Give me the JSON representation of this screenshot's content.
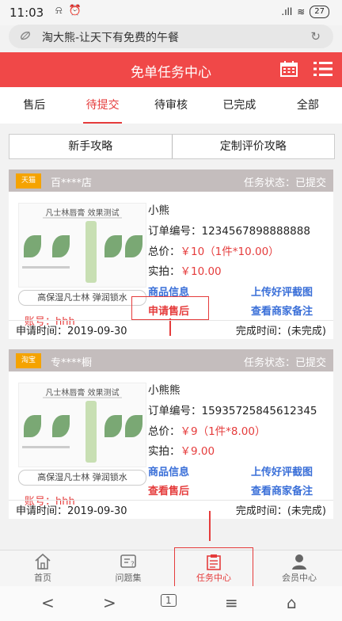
{
  "status_bar": {
    "time": "11:03",
    "alarm_icons": "⍾ ⏰",
    "signal": ".ıll",
    "wifi": "≋",
    "battery": "27"
  },
  "browser": {
    "page_title": "淘大熊-让天下有免费的午餐"
  },
  "header": {
    "title": "免单任务中心"
  },
  "tabs": [
    "售后",
    "待提交",
    "待审核",
    "已完成",
    "全部"
  ],
  "active_tab": "待提交",
  "guides": {
    "newbie": "新手攻略",
    "custom_review": "定制评价攻略"
  },
  "product_image": {
    "title": "凡士林唇膏 效果测试",
    "caption": "高保湿凡士林 弹润锁水"
  },
  "labels": {
    "order_no": "订单编号：",
    "total": "总价：",
    "actual": "实拍：",
    "account": "账号：",
    "product_info": "商品信息",
    "upload_review": "上传好评截图",
    "merchant_note": "查看商家备注",
    "apply_time": "申请时间：",
    "finish_time": "完成时间："
  },
  "tasks": [
    {
      "tag": "天猫",
      "store": "百****店",
      "task_state": "任务状态：已提交",
      "buyer": "小熊",
      "order_no": "1234567898888888",
      "total": "￥10（1件*10.00）",
      "actual": "￥10.00",
      "account": "hhh",
      "after_sale": "申请售后",
      "apply_time": "2019-09-30",
      "finish_time": "(未完成)"
    },
    {
      "tag": "淘宝",
      "store": "专****橱",
      "task_state": "任务状态：已提交",
      "buyer": "小熊熊",
      "order_no": "15935725845612345",
      "total": "￥9（1件*8.00）",
      "actual": "￥9.00",
      "account": "hhh",
      "after_sale": "查看售后",
      "apply_time": "2019-09-30",
      "finish_time": "(未完成)"
    }
  ],
  "bottom_nav": [
    {
      "label": "首页",
      "icon": "home-icon"
    },
    {
      "label": "问题集",
      "icon": "faq-icon"
    },
    {
      "label": "任务中心",
      "icon": "clipboard-icon"
    },
    {
      "label": "会员中心",
      "icon": "user-icon"
    }
  ],
  "active_nav": "任务中心",
  "system_nav": {
    "page_count": "1"
  },
  "colors": {
    "accent": "#f04848",
    "link": "#3a6fd8",
    "tag": "#f5a300",
    "card_header": "#c4bdbd"
  }
}
